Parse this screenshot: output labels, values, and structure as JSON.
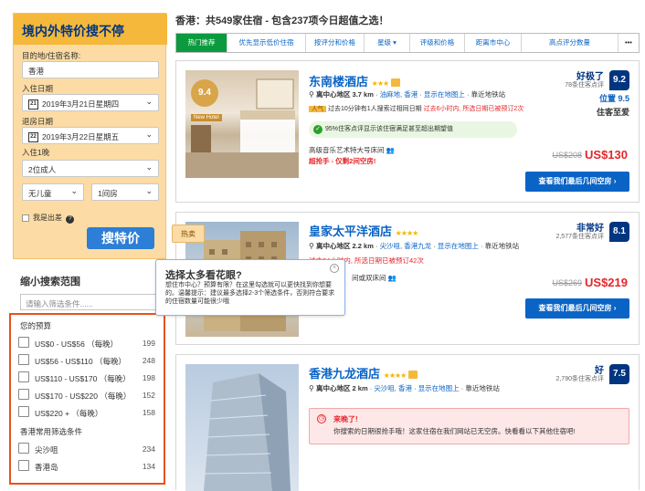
{
  "search": {
    "title": "境内外特价搜不停",
    "dest_label": "目的地/住宿名称:",
    "dest_value": "香港",
    "checkin_label": "入住日期",
    "checkin_value": "2019年3月21日星期四",
    "checkin_day": "21",
    "checkout_label": "退房日期",
    "checkout_value": "2019年3月22日星期五",
    "checkout_day": "22",
    "nights_label": "入住1晚",
    "adults_value": "2位成人",
    "children_value": "无儿童",
    "rooms_value": "1间房",
    "business_label": "我是出差",
    "button": "搜特价"
  },
  "filters": {
    "title": "缩小搜索范围",
    "input_placeholder": "请输入筛选条件......",
    "budget_title": "您的预算",
    "budget": [
      {
        "label": "US$0 - US$56 （每晚）",
        "count": "199"
      },
      {
        "label": "US$56 - US$110 （每晚）",
        "count": "248"
      },
      {
        "label": "US$110 - US$170 （每晚）",
        "count": "198"
      },
      {
        "label": "US$170 - US$220 （每晚）",
        "count": "152"
      },
      {
        "label": "US$220 + （每晚）",
        "count": "158"
      }
    ],
    "common_title": "香港常用筛选条件",
    "common": [
      {
        "label": "尖沙咀",
        "count": "234"
      },
      {
        "label": "香港岛",
        "count": "134"
      }
    ]
  },
  "heading": "香港：共549家住宿 - 包含237项今日超值之选！",
  "tabs": [
    "热门推荐",
    "优先显示低价住宿",
    "按评分和价格",
    "星级 ▾",
    "评级和价格",
    "距离市中心",
    "高点评分数量",
    "•••"
  ],
  "tooltip": {
    "title": "选择太多看花眼?",
    "body": "想住市中心？预算有限？在这里勾选就可以更快找到你想要的。温馨提示：建议最多选择2-3个筛选条件，否则符合要求的住宿数量可能很少哦",
    "close": "×"
  },
  "hot_tag": "热卖",
  "hotels": [
    {
      "name": "东南楼酒店",
      "stars": "★★★",
      "photo_score": "9.4",
      "photo_tag": "New Hotel",
      "district": "离中心地区 3.7 km",
      "area": "油麻地, 香港",
      "map_link": "显示在地图上",
      "near": "靠近地铁站",
      "popular_tag": "人气",
      "recent": "过去10分钟有1人搜索过相同日期",
      "booked": "过去6小时内, 所选日期已被预订2次",
      "note": "95%住客点评显示该住宿满足甚至超出期望值",
      "room": "高级音乐艺术特大号床间",
      "deal": "超抢手 - 仅剩2间空房!",
      "rating_word": "好极了",
      "rating_count": "78条住客点评",
      "score": "9.2",
      "location_score": "位置 9.5",
      "tagline": "住客至爱",
      "old_price": "US$208",
      "price": "US$130",
      "cta": "查看我们最后几间空房 ›"
    },
    {
      "name": "皇家太平洋酒店",
      "stars": "★★★★",
      "district": "离中心地区 2.2 km",
      "area": "尖沙咀, 香港九龙",
      "map_link": "显示在地图上",
      "near": "靠近地铁站",
      "booked": "过去24小时内, 所选日期已被预订42次",
      "room": "间或双床间",
      "rating_word": "非常好",
      "rating_count": "2,577条住客点评",
      "score": "8.1",
      "old_price": "US$269",
      "price": "US$219",
      "cta": "查看我们最后几间空房 ›"
    },
    {
      "name": "香港九龙酒店",
      "stars": "★★★★",
      "district": "离中心地区 2 km",
      "area": "尖沙咀, 香港",
      "map_link": "显示在地图上",
      "near": "靠近地铁站",
      "rating_word": "好",
      "rating_count": "2,790条住客点评",
      "score": "7.5",
      "alert_title": "来晚了!",
      "alert_body": "你搜索的日期很抢手哦！这家住宿在我们网站已无空房。快看看以下其他住宿吧!"
    }
  ]
}
